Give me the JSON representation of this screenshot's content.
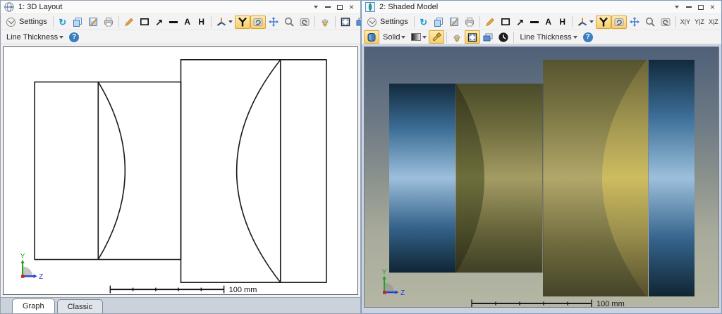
{
  "windows": [
    {
      "title": "1: 3D Layout",
      "toolbar": {
        "settings": "Settings",
        "line_thickness": "Line Thickness"
      },
      "tabs": {
        "graph": "Graph",
        "classic": "Classic"
      },
      "viewport": {
        "scale_label": "100 mm",
        "axis_y": "Y",
        "axis_z": "Z"
      }
    },
    {
      "title": "2: Shaded Model",
      "toolbar": {
        "settings": "Settings",
        "solid": "Solid",
        "line_thickness": "Line Thickness",
        "plane_xy": "X|Y",
        "plane_yz": "Y|Z",
        "plane_xz": "X|Z"
      },
      "viewport": {
        "scale_label": "100 mm",
        "axis_y": "Y",
        "axis_z": "Z"
      }
    }
  ],
  "glyphs": {
    "refresh": "↻",
    "reset": "↺",
    "arrow_tool": "↗",
    "text_tool_a": "A",
    "text_tool_h": "H",
    "help": "?",
    "close": "×"
  },
  "colors": {
    "toolbar_highlight_bg": "#f7cf6e",
    "toolbar_highlight_border": "#d9a43a",
    "accent_blue": "#1f97d4",
    "shaded_bg_top": "#4f6078",
    "shaded_bg_bottom": "#b5b7a4",
    "lens_blue_mid": "#9cbfdc",
    "lens_gold_mid": "#b2a769",
    "axis_y_color": "#1fa41f",
    "axis_z_color": "#2a3fd4",
    "axis_origin_color": "#cc2222"
  }
}
